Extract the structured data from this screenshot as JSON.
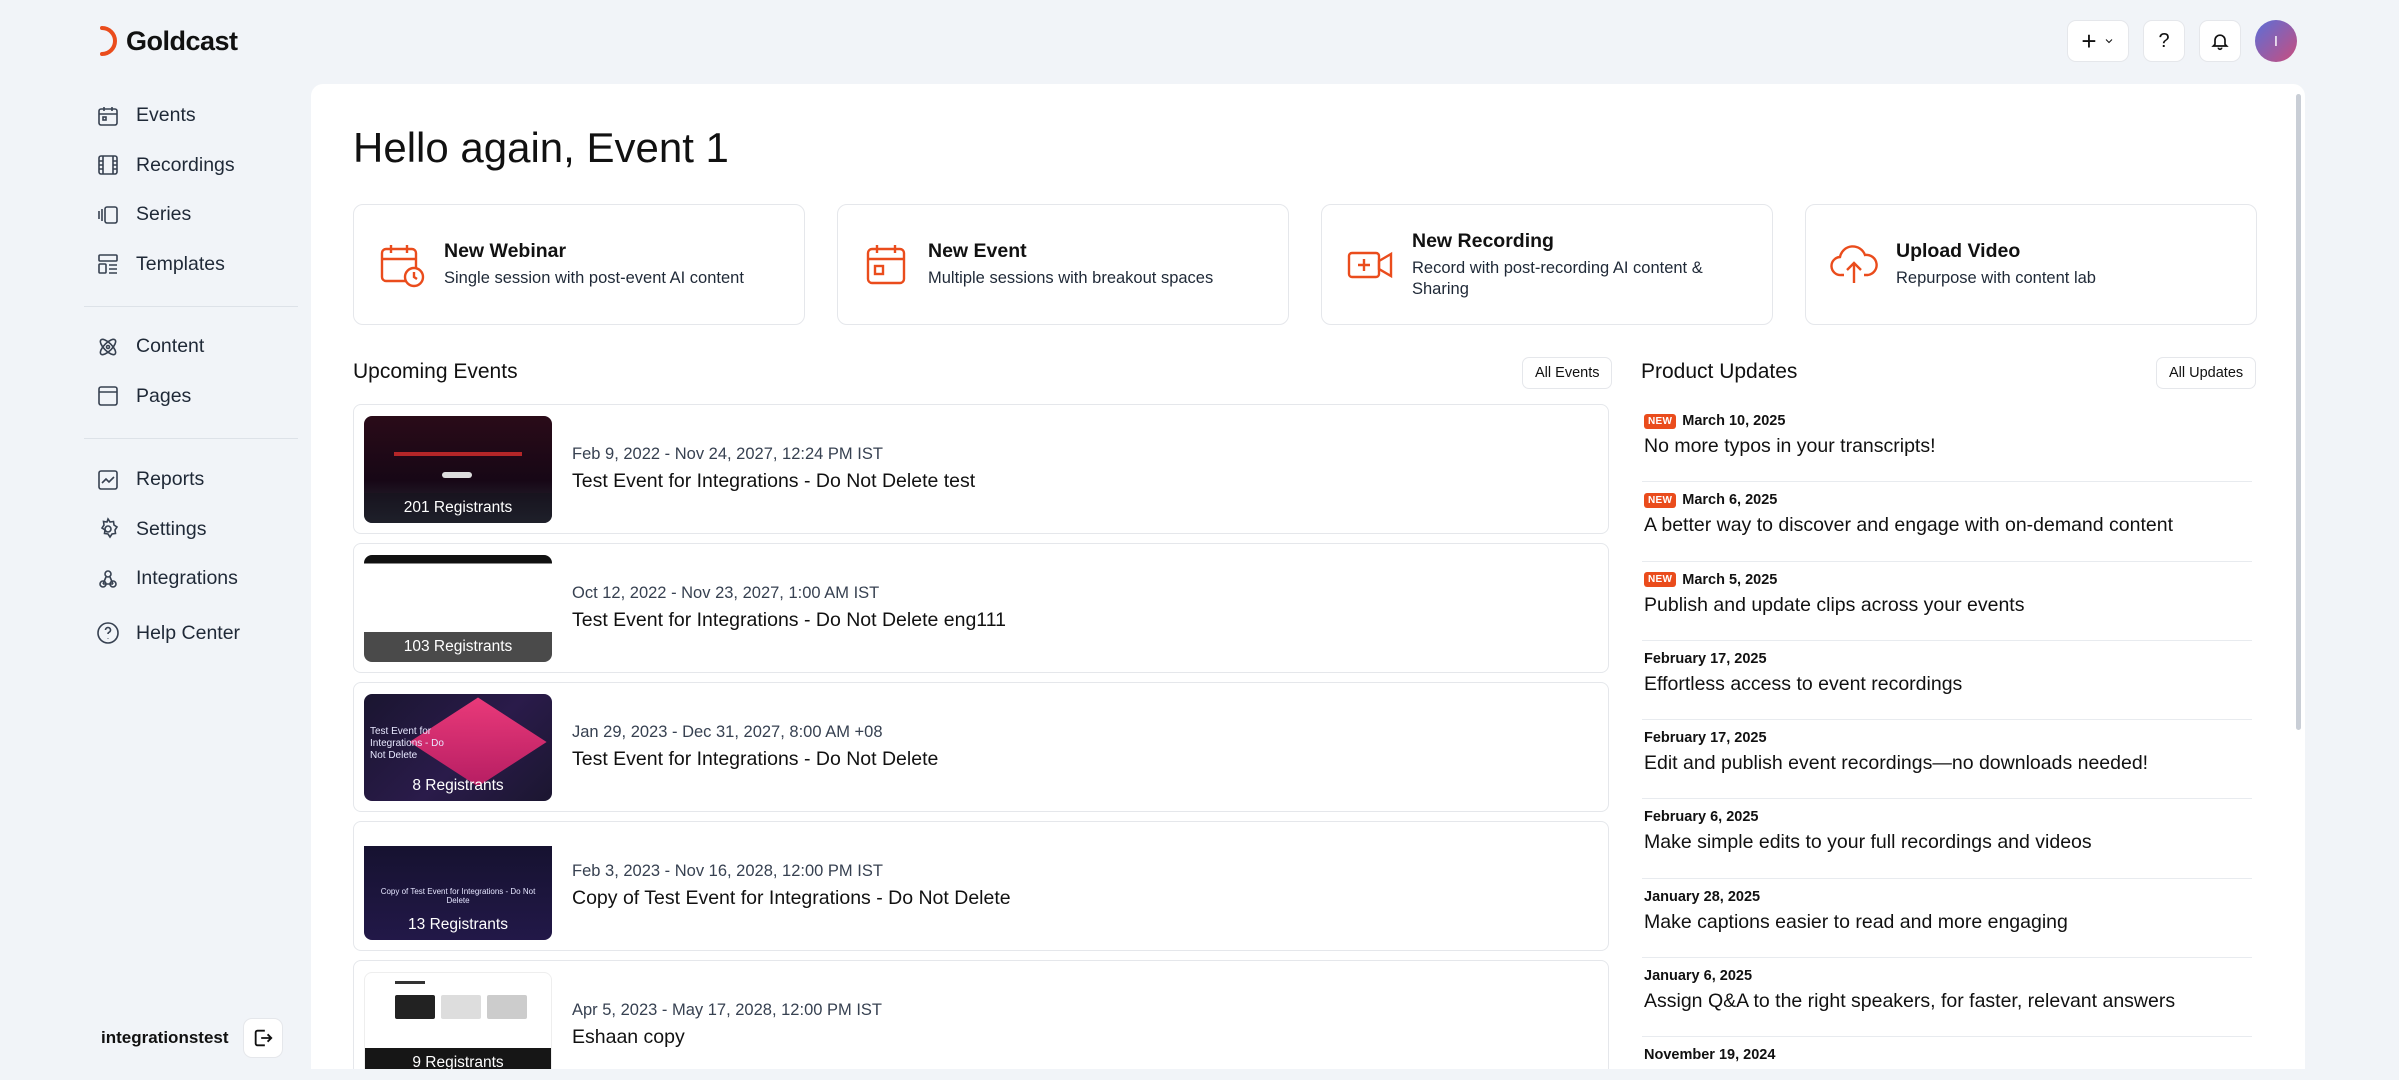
{
  "brand": {
    "name": "Goldcast"
  },
  "sidebar": {
    "group1": [
      {
        "label": "Events",
        "icon": "calendar-icon"
      },
      {
        "label": "Recordings",
        "icon": "film-icon"
      },
      {
        "label": "Series",
        "icon": "series-icon"
      },
      {
        "label": "Templates",
        "icon": "template-icon"
      }
    ],
    "group2": [
      {
        "label": "Content",
        "icon": "atom-icon"
      },
      {
        "label": "Pages",
        "icon": "page-icon"
      }
    ],
    "group3": [
      {
        "label": "Reports",
        "icon": "chart-icon"
      },
      {
        "label": "Settings",
        "icon": "gear-icon"
      },
      {
        "label": "Integrations",
        "icon": "webhook-icon"
      },
      {
        "label": "Help Center",
        "icon": "help-circle-icon"
      }
    ],
    "username": "integrationstest"
  },
  "topbar": {
    "add_label": "+",
    "help_label": "?",
    "avatar_initial": "I"
  },
  "main": {
    "greeting": "Hello again, Event 1",
    "quick_actions": [
      {
        "title": "New Webinar",
        "desc": "Single session with post-event AI content",
        "icon": "calendar-clock-icon"
      },
      {
        "title": "New Event",
        "desc": "Multiple sessions with breakout spaces",
        "icon": "calendar-icon"
      },
      {
        "title": "New Recording",
        "desc": "Record with post-recording AI content & Sharing",
        "icon": "video-plus-icon"
      },
      {
        "title": "Upload Video",
        "desc": "Repurpose with content lab",
        "icon": "cloud-upload-icon"
      }
    ],
    "upcoming": {
      "title": "Upcoming Events",
      "all_label": "All Events",
      "events": [
        {
          "date": "Feb 9, 2022 - Nov 24, 2027, 12:24 PM IST",
          "name": "Test Event for Integrations - Do Not Delete test",
          "registrants": "201 Registrants"
        },
        {
          "date": "Oct 12, 2022 - Nov 23, 2027, 1:00 AM IST",
          "name": "Test Event for Integrations - Do Not Delete eng111",
          "registrants": "103 Registrants"
        },
        {
          "date": "Jan 29, 2023 - Dec 31, 2027, 8:00 AM +08",
          "name": "Test Event for Integrations - Do Not Delete",
          "registrants": "8 Registrants",
          "thumb_text": "Test Event for Integrations - Do Not Delete"
        },
        {
          "date": "Feb 3, 2023 - Nov 16, 2028, 12:00 PM IST",
          "name": "Copy of Test Event for Integrations - Do Not Delete",
          "registrants": "13 Registrants",
          "thumb_text": "Copy of Test Event for Integrations - Do Not Delete"
        },
        {
          "date": "Apr 5, 2023 - May 17, 2028, 12:00 PM IST",
          "name": "Eshaan copy",
          "registrants": "9 Registrants"
        }
      ]
    },
    "product_updates": {
      "title": "Product Updates",
      "all_label": "All Updates",
      "badge": "NEW",
      "items": [
        {
          "date": "March 10, 2025",
          "title": "No more typos in your transcripts!",
          "is_new": true
        },
        {
          "date": "March 6, 2025",
          "title": "A better way to discover and engage with on-demand content",
          "is_new": true
        },
        {
          "date": "March 5, 2025",
          "title": "Publish and update clips across your events",
          "is_new": true
        },
        {
          "date": "February 17, 2025",
          "title": "Effortless access to event recordings",
          "is_new": false
        },
        {
          "date": "February 17, 2025",
          "title": "Edit and publish event recordings—no downloads needed!",
          "is_new": false
        },
        {
          "date": "February 6, 2025",
          "title": "Make simple edits to your full recordings and videos",
          "is_new": false
        },
        {
          "date": "January 28, 2025",
          "title": "Make captions easier to read and more engaging",
          "is_new": false
        },
        {
          "date": "January 6, 2025",
          "title": "Assign Q&A to the right speakers, for faster, relevant answers",
          "is_new": false
        },
        {
          "date": "November 19, 2024",
          "title": "",
          "is_new": false
        }
      ]
    }
  },
  "colors": {
    "accent": "#ea4c1c",
    "background": "#f1f4f8"
  }
}
